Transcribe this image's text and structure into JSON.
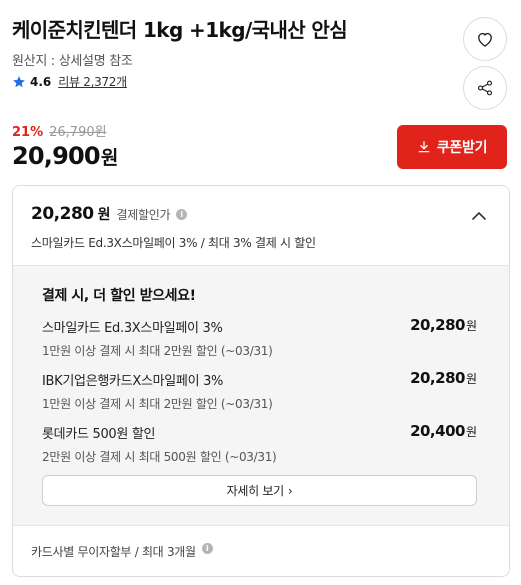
{
  "product": {
    "title": "케이준치킨텐더 1kg +1kg/국내산 안심",
    "origin": "원산지 : 상세설명 참조",
    "rating": "4.6",
    "review_link": "리뷰 2,372개"
  },
  "price": {
    "discount_rate": "21%",
    "original_price": "26,790원",
    "sale_price": "20,900",
    "sale_unit": "원",
    "coupon_button": "쿠폰받기"
  },
  "discount_box": {
    "pay_price": "20,280",
    "pay_unit": "원",
    "pay_label": "결제할인가",
    "info_glyph": "i",
    "summary": "스마일카드 Ed.3X스마일페이 3% / 최대 3% 결제 시 할인",
    "heading": "결제 시, 더 할인 받으세요!",
    "cards": [
      {
        "name": "스마일카드 Ed.3X스마일페이 3%",
        "desc": "1만원 이상 결제 시 최대 2만원 할인 (~03/31)",
        "price": "20,280",
        "unit": "원"
      },
      {
        "name": "IBK기업은행카드X스마일페이 3%",
        "desc": "1만원 이상 결제 시 최대 2만원 할인 (~03/31)",
        "price": "20,280",
        "unit": "원"
      },
      {
        "name": "롯데카드 500원 할인",
        "desc": "2만원 이상 결제 시 최대 500원 할인 (~03/31)",
        "price": "20,400",
        "unit": "원"
      }
    ],
    "more_button": "자세히 보기",
    "more_chevron": "›",
    "footer": "카드사별 무이자할부 / 최대 3개월"
  },
  "colors": {
    "accent_red": "#e0241b",
    "star_blue": "#1f6fe5",
    "muted_gray": "#999999"
  },
  "icons": {
    "heart": "heart-icon",
    "share": "share-icon",
    "download": "download-icon",
    "chevron_up": "chevron-up-icon",
    "star": "star-icon",
    "info": "info-icon"
  }
}
